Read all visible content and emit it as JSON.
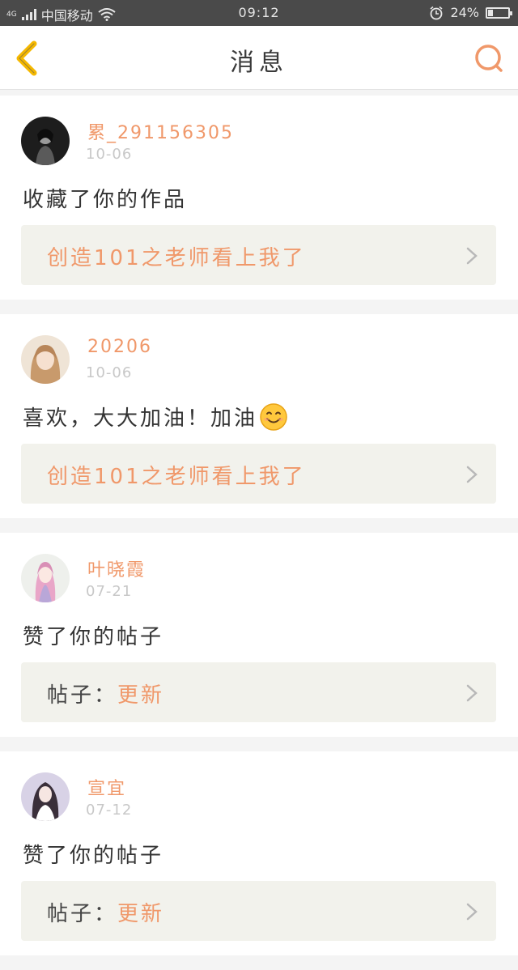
{
  "status_bar": {
    "network": "4G",
    "carrier": "中国移动",
    "time": "09:12",
    "battery_percent": "24%",
    "battery_level": 0.24
  },
  "header": {
    "title": "消息",
    "back_icon": "chevron-left-icon",
    "search_icon": "search-icon"
  },
  "colors": {
    "accent": "#f0986a",
    "back_icon": "#f5b800",
    "status_bg": "#4a4a4a"
  },
  "messages": [
    {
      "user": "累_291156305",
      "date": "10-06",
      "text": "收藏了你的作品",
      "link_prefix": "",
      "link_text": "创造101之老师看上我了"
    },
    {
      "user": "20206",
      "date": "10-06",
      "text": "喜欢，大大加油！加油",
      "emoji": "smiley-emoji",
      "link_prefix": "",
      "link_text": "创造101之老师看上我了"
    },
    {
      "user": "叶晓霞",
      "date": "07-21",
      "text": "赞了你的帖子",
      "link_prefix": "帖子：",
      "link_text": "更新"
    },
    {
      "user": "宣宜",
      "date": "07-12",
      "text": "赞了你的帖子",
      "link_prefix": "帖子：",
      "link_text": "更新"
    }
  ]
}
